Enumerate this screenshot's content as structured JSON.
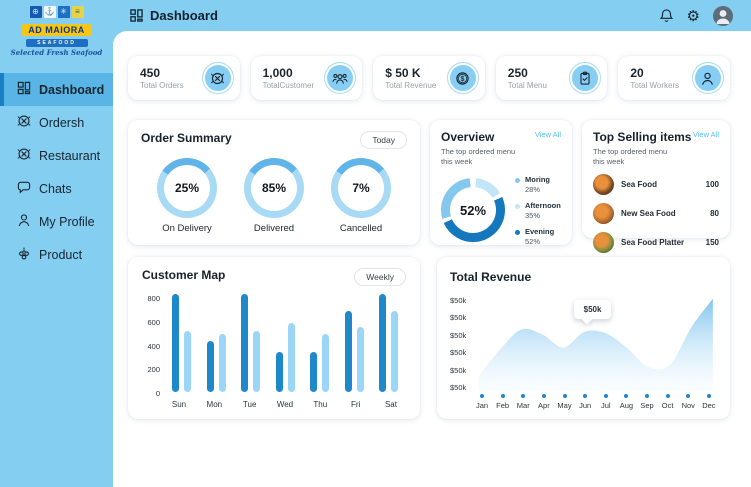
{
  "logo": {
    "title": "AD MAIORA",
    "subtitle": "SEAFOOD",
    "tagline": "Selected Fresh Seafood"
  },
  "header": {
    "title": "Dashboard",
    "icons": [
      "bell-icon",
      "gear-icon",
      "avatar"
    ]
  },
  "sidebar": {
    "items": [
      {
        "label": "Dashboard",
        "icon": "grid-icon",
        "active": true
      },
      {
        "label": "Ordersh",
        "icon": "dish-icon",
        "active": false
      },
      {
        "label": "Restaurant",
        "icon": "dish-icon",
        "active": false
      },
      {
        "label": "Chats",
        "icon": "chat-icon",
        "active": false
      },
      {
        "label": "My Profile",
        "icon": "profile-icon",
        "active": false
      },
      {
        "label": "Product",
        "icon": "product-icon",
        "active": false
      }
    ]
  },
  "stats": [
    {
      "value": "450",
      "label": "Total Orders",
      "icon": "orders-dish-icon"
    },
    {
      "value": "1,000",
      "label": "TotalCustomer",
      "icon": "customers-group-icon"
    },
    {
      "value": "$ 50 K",
      "label": "Total Revenue",
      "icon": "dollar-coin-icon"
    },
    {
      "value": "250",
      "label": "Total Menu",
      "icon": "menu-clipboard-icon"
    },
    {
      "value": "20",
      "label": "Total Workers",
      "icon": "worker-person-icon"
    }
  ],
  "order_summary": {
    "title": "Order Summary",
    "filter_label": "Today",
    "donuts": [
      {
        "pct": "25%",
        "label": "On Delivery"
      },
      {
        "pct": "85%",
        "label": "Delivered"
      },
      {
        "pct": "7%",
        "label": "Cancelled"
      }
    ]
  },
  "overview": {
    "title": "Overview",
    "link": "View All",
    "subtitle": "The top ordered menu this week",
    "center_pct": "52%",
    "legend": [
      {
        "label": "Moring",
        "pct": "28%",
        "color": "#85c8ef"
      },
      {
        "label": "Afternoon",
        "pct": "35%",
        "color": "#c2e5f9"
      },
      {
        "label": "Evening",
        "pct": "52%",
        "color": "#1478be"
      }
    ]
  },
  "top_selling": {
    "title": "Top Selling items",
    "link": "View All",
    "subtitle": "The top ordered menu this week",
    "items": [
      {
        "name": "Sea Food",
        "qty": "100",
        "img_color": "#7a4a22"
      },
      {
        "name": "New Sea Food",
        "qty": "80",
        "img_color": "#b36a2e"
      },
      {
        "name": "Sea Food Platter",
        "qty": "150",
        "img_color": "#7a8f3c"
      }
    ]
  },
  "colors": {
    "sidebar_bg": "#84cef2",
    "active_item": "#58b5e6",
    "accent_dark_blue": "#1e88c8",
    "accent_light_blue": "#9cd6f7",
    "link_blue": "#53c0f2",
    "donut_ring": "#a8daf5",
    "donut_arc": "#60b4e8"
  },
  "chart_data": [
    {
      "type": "bar",
      "title": "Customer Map",
      "filter_label": "Weekly",
      "categories": [
        "Sun",
        "Mon",
        "Tue",
        "Wed",
        "Thu",
        "Fri",
        "Sat"
      ],
      "series": [
        {
          "name": "primary",
          "color": "#1e88c8",
          "values": [
            800,
            420,
            800,
            330,
            330,
            660,
            800
          ]
        },
        {
          "name": "secondary",
          "color": "#9cd6f7",
          "values": [
            500,
            470,
            500,
            560,
            470,
            530,
            660
          ]
        }
      ],
      "yticks": [
        0,
        200,
        400,
        600,
        800
      ],
      "ylim": [
        0,
        800
      ],
      "grid": false,
      "legend_position": "none"
    },
    {
      "type": "area",
      "title": "Total Revenue",
      "x": [
        "Jan",
        "Feb",
        "Mar",
        "Apr",
        "May",
        "Jun",
        "Jul",
        "Aug",
        "Sep",
        "Oct",
        "Nov",
        "Dec"
      ],
      "values_rel": [
        0.12,
        0.4,
        0.62,
        0.57,
        0.43,
        0.6,
        0.58,
        0.42,
        0.22,
        0.25,
        0.65,
        0.95
      ],
      "ytick_label": "$50k",
      "ytick_count": 6,
      "tooltip": {
        "label": "$50k",
        "x": "Jun"
      },
      "fill_color": "#7cc2ee",
      "dot_color": "#1e88c8",
      "grid": false
    }
  ]
}
